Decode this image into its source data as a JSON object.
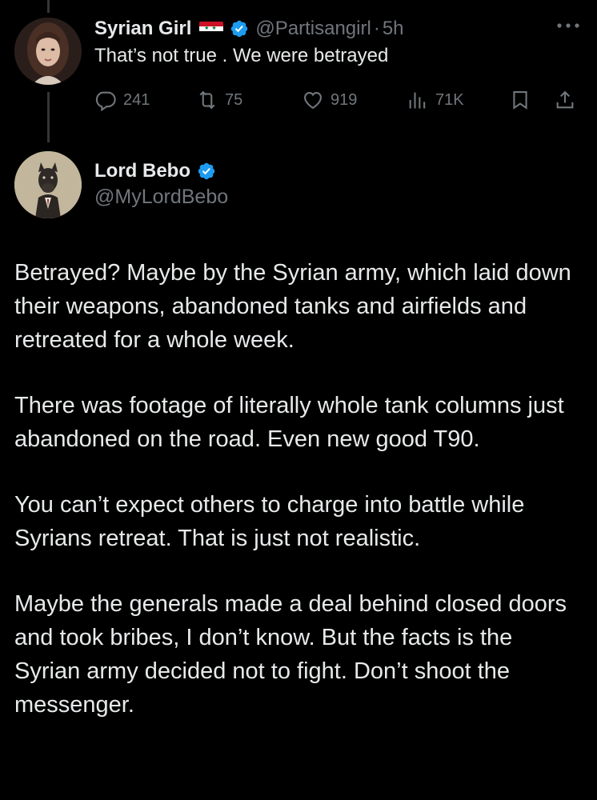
{
  "parent_tweet": {
    "author_name": "Syrian Girl",
    "author_handle": "@Partisangirl",
    "separator": "·",
    "time": "5h",
    "text": "That’s not true . We were betrayed",
    "stats": {
      "replies": "241",
      "reposts": "75",
      "likes": "919",
      "views": "71K"
    },
    "icons": [
      "syria-flag-icon",
      "verified-badge-icon",
      "more-icon",
      "reply-icon",
      "repost-icon",
      "like-icon",
      "views-icon",
      "bookmark-icon",
      "share-icon"
    ]
  },
  "main_tweet": {
    "author_name": "Lord Bebo",
    "author_handle": "@MyLordBebo",
    "paragraphs": [
      "Betrayed? Maybe by the Syrian army, which laid down their weapons, abandoned tanks and airfields and retreated for a whole week.",
      "There was footage of literally whole tank columns just abandoned on the road. Even new good T90.",
      "You can’t expect others to charge into battle while Syrians retreat. That is just not realistic.",
      "Maybe the generals made a deal behind closed doors and took bribes, I don’t know. But the facts is the Syrian army decided not to fight. Don’t shoot the messenger."
    ]
  },
  "colors": {
    "background": "#000000",
    "primary_text": "#e7e9ea",
    "secondary_text": "#71767b",
    "verified_blue": "#1d9bf0",
    "thread_line": "#333639"
  }
}
